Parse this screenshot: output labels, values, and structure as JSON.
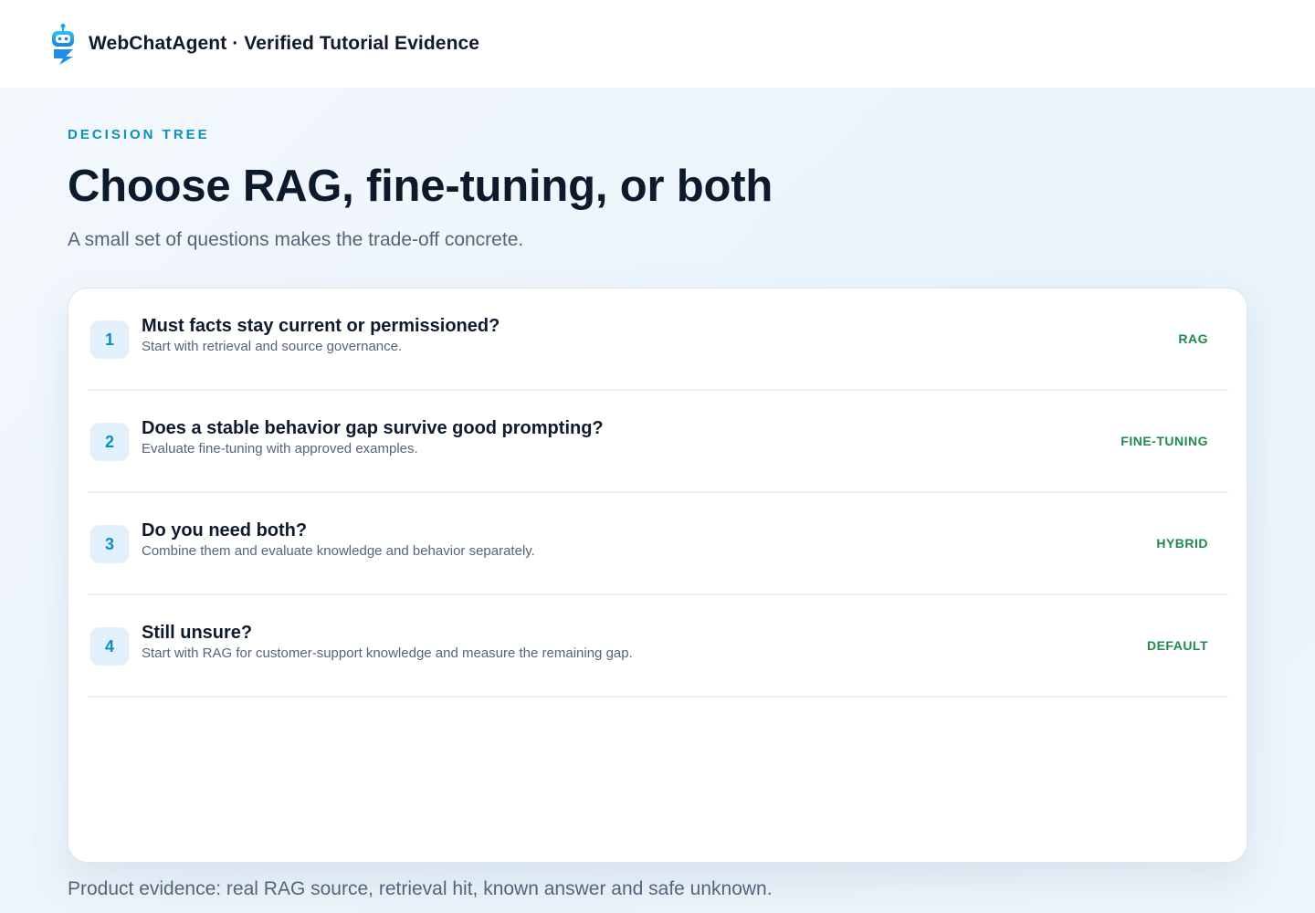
{
  "header": {
    "brand": "WebChatAgent · Verified Tutorial Evidence",
    "logo_icon": "robot-icon",
    "accent": "#0a8fc1"
  },
  "hero": {
    "eyebrow": "DECISION TREE",
    "title": "Choose RAG, fine-tuning, or both",
    "subtitle": "A small set of questions makes the trade-off concrete."
  },
  "decisions": [
    {
      "number": "1",
      "question": "Must facts stay current or permissioned?",
      "answer": "Start with retrieval and source governance.",
      "tag": "RAG"
    },
    {
      "number": "2",
      "question": "Does a stable behavior gap survive good prompting?",
      "answer": "Evaluate fine-tuning with approved examples.",
      "tag": "FINE-TUNING"
    },
    {
      "number": "3",
      "question": "Do you need both?",
      "answer": "Combine them and evaluate knowledge and behavior separately.",
      "tag": "HYBRID"
    },
    {
      "number": "4",
      "question": "Still unsure?",
      "answer": "Start with RAG for customer-support knowledge and measure the remaining gap.",
      "tag": "DEFAULT"
    }
  ],
  "footer": {
    "note": "Product evidence: real RAG source, retrieval hit, known answer and safe unknown."
  },
  "colors": {
    "tag_green": "#1f8a4a",
    "number_badge_bg": "#e2f1fb",
    "title_dark": "#0c1a2c"
  }
}
